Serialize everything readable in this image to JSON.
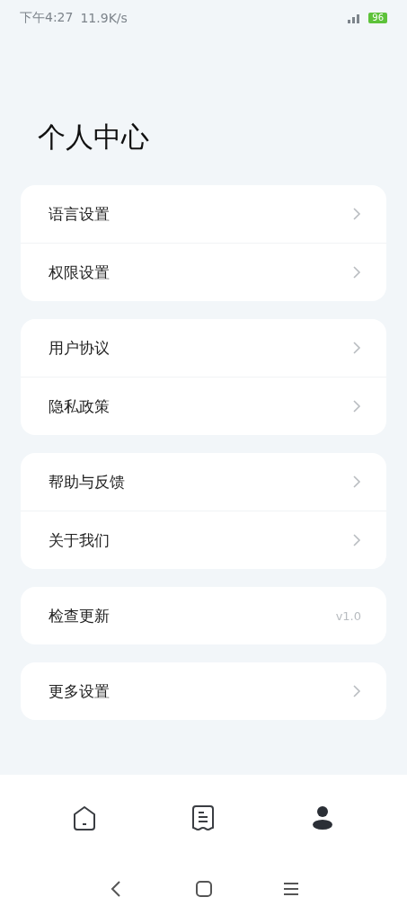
{
  "status_bar": {
    "time": "下午4:27",
    "speed": "11.9K/s",
    "battery": "96"
  },
  "title": "个人中心",
  "groups": [
    {
      "items": [
        {
          "label": "语言设置",
          "kind": "chevron"
        },
        {
          "label": "权限设置",
          "kind": "chevron"
        }
      ]
    },
    {
      "items": [
        {
          "label": "用户协议",
          "kind": "chevron"
        },
        {
          "label": "隐私政策",
          "kind": "chevron"
        }
      ]
    },
    {
      "items": [
        {
          "label": "帮助与反馈",
          "kind": "chevron"
        },
        {
          "label": "关于我们",
          "kind": "chevron"
        }
      ]
    },
    {
      "items": [
        {
          "label": "检查更新",
          "kind": "version",
          "value": "v1.0"
        }
      ]
    },
    {
      "items": [
        {
          "label": "更多设置",
          "kind": "chevron"
        }
      ]
    }
  ],
  "tabs": [
    {
      "kind": "home",
      "selected": false
    },
    {
      "kind": "list",
      "selected": false
    },
    {
      "kind": "profile",
      "selected": true
    }
  ]
}
